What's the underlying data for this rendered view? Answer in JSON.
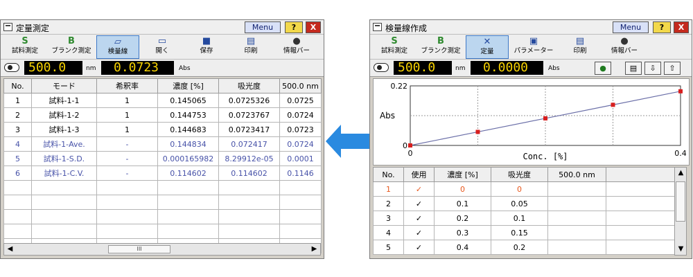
{
  "left_window": {
    "title": "定量測定",
    "menu_label": "Menu",
    "help_label": "?",
    "close_label": "X",
    "toolbar": [
      {
        "id": "sample-measure",
        "label": "試料測定",
        "icon": "sample-measure-icon",
        "glyph": "S",
        "active": false
      },
      {
        "id": "blank-measure",
        "label": "ブランク測定",
        "icon": "blank-measure-icon",
        "glyph": "B",
        "active": false
      },
      {
        "id": "calibration-curve",
        "label": "検量線",
        "icon": "calibration-curve-icon",
        "glyph": "▱",
        "active": true
      },
      {
        "id": "open",
        "label": "開く",
        "icon": "open-folder-icon",
        "glyph": "▭",
        "active": false
      },
      {
        "id": "save",
        "label": "保存",
        "icon": "save-disk-icon",
        "glyph": "■",
        "active": false
      },
      {
        "id": "print",
        "label": "印刷",
        "icon": "printer-icon",
        "glyph": "▤",
        "active": false
      },
      {
        "id": "info-bar",
        "label": "情報バー",
        "icon": "info-icon",
        "glyph": "●",
        "active": false
      }
    ],
    "readout": {
      "wavelength": "500.0",
      "wavelength_unit": "nm",
      "value": "0.0723",
      "value_unit": "Abs"
    },
    "table": {
      "headers": [
        "No.",
        "モード",
        "希釈率",
        "濃度 [%]",
        "吸光度",
        "500.0 nm"
      ],
      "rows": [
        {
          "style": "normal",
          "cells": [
            "1",
            "試料-1-1",
            "1",
            "0.145065",
            "0.0725326",
            "0.0725"
          ]
        },
        {
          "style": "normal",
          "cells": [
            "2",
            "試料-1-2",
            "1",
            "0.144753",
            "0.0723767",
            "0.0724"
          ]
        },
        {
          "style": "normal",
          "cells": [
            "3",
            "試料-1-3",
            "1",
            "0.144683",
            "0.0723417",
            "0.0723"
          ]
        },
        {
          "style": "ave",
          "cells": [
            "4",
            "試料-1-Ave.",
            "-",
            "0.144834",
            "0.072417",
            "0.0724"
          ]
        },
        {
          "style": "ave",
          "cells": [
            "5",
            "試料-1-S.D.",
            "-",
            "0.000165982",
            "8.29912e-05",
            "0.0001"
          ]
        },
        {
          "style": "ave",
          "cells": [
            "6",
            "試料-1-C.V.",
            "-",
            "0.114602",
            "0.114602",
            "0.1146"
          ]
        },
        {
          "style": "empty",
          "cells": [
            "",
            "",
            "",
            "",
            "",
            ""
          ]
        },
        {
          "style": "empty",
          "cells": [
            "",
            "",
            "",
            "",
            "",
            ""
          ]
        },
        {
          "style": "empty",
          "cells": [
            "",
            "",
            "",
            "",
            "",
            ""
          ]
        },
        {
          "style": "empty",
          "cells": [
            "",
            "",
            "",
            "",
            "",
            ""
          ]
        },
        {
          "style": "empty",
          "cells": [
            "",
            "",
            "",
            "",
            "",
            ""
          ]
        }
      ]
    },
    "hscroll_thumb": "III"
  },
  "right_window": {
    "title": "検量線作成",
    "menu_label": "Menu",
    "help_label": "?",
    "close_label": "X",
    "toolbar": [
      {
        "id": "sample-measure",
        "label": "試料測定",
        "icon": "sample-measure-icon",
        "glyph": "S",
        "active": false
      },
      {
        "id": "blank-measure",
        "label": "ブランク測定",
        "icon": "blank-measure-icon",
        "glyph": "B",
        "active": false
      },
      {
        "id": "quantitation",
        "label": "定量",
        "icon": "quantitation-icon",
        "glyph": "✕",
        "active": true
      },
      {
        "id": "parameter",
        "label": "パラメーター",
        "icon": "parameter-icon",
        "glyph": "▣",
        "active": false
      },
      {
        "id": "print",
        "label": "印刷",
        "icon": "printer-icon",
        "glyph": "▤",
        "active": false
      },
      {
        "id": "info-bar",
        "label": "情報バー",
        "icon": "info-icon",
        "glyph": "●",
        "active": false
      }
    ],
    "readout": {
      "wavelength": "500.0",
      "wavelength_unit": "nm",
      "value": "0.0000",
      "value_unit": "Abs"
    },
    "readout_buttons": [
      {
        "icon": "info-icon",
        "glyph": "●"
      },
      {
        "icon": "list-icon",
        "glyph": "▤"
      },
      {
        "icon": "download-icon",
        "glyph": "⇩"
      },
      {
        "icon": "upload-icon",
        "glyph": "⇧"
      }
    ],
    "table": {
      "headers": [
        "No.",
        "使用",
        "濃度 [%]",
        "吸光度",
        "500.0 nm",
        ""
      ],
      "rows": [
        {
          "style": "red",
          "cells": [
            "1",
            "✓",
            "0",
            "0",
            "",
            ""
          ]
        },
        {
          "style": "normal",
          "cells": [
            "2",
            "✓",
            "0.1",
            "0.05",
            "",
            ""
          ]
        },
        {
          "style": "normal",
          "cells": [
            "3",
            "✓",
            "0.2",
            "0.1",
            "",
            ""
          ]
        },
        {
          "style": "normal",
          "cells": [
            "4",
            "✓",
            "0.3",
            "0.15",
            "",
            ""
          ]
        },
        {
          "style": "normal",
          "cells": [
            "5",
            "✓",
            "0.4",
            "0.2",
            "",
            ""
          ]
        }
      ]
    }
  },
  "chart_data": {
    "type": "line",
    "x": [
      0,
      0.1,
      0.2,
      0.3,
      0.4
    ],
    "values": [
      0,
      0.05,
      0.1,
      0.15,
      0.2
    ],
    "xlabel": "Conc. [%]",
    "ylabel": "Abs",
    "xlim": [
      0,
      0.4
    ],
    "ylim": [
      0,
      0.22
    ],
    "x_ticks": [
      "0",
      "0.4"
    ],
    "y_ticks": [
      "0",
      "0.22"
    ],
    "grid": true,
    "line_color": "#6b6fa8",
    "marker_color": "#d81f1f"
  },
  "colors": {
    "arrow": "#2a8ae0",
    "lcd_text": "#f7d200",
    "ave_text": "#4752a8",
    "highlight_text": "#e8571c"
  }
}
